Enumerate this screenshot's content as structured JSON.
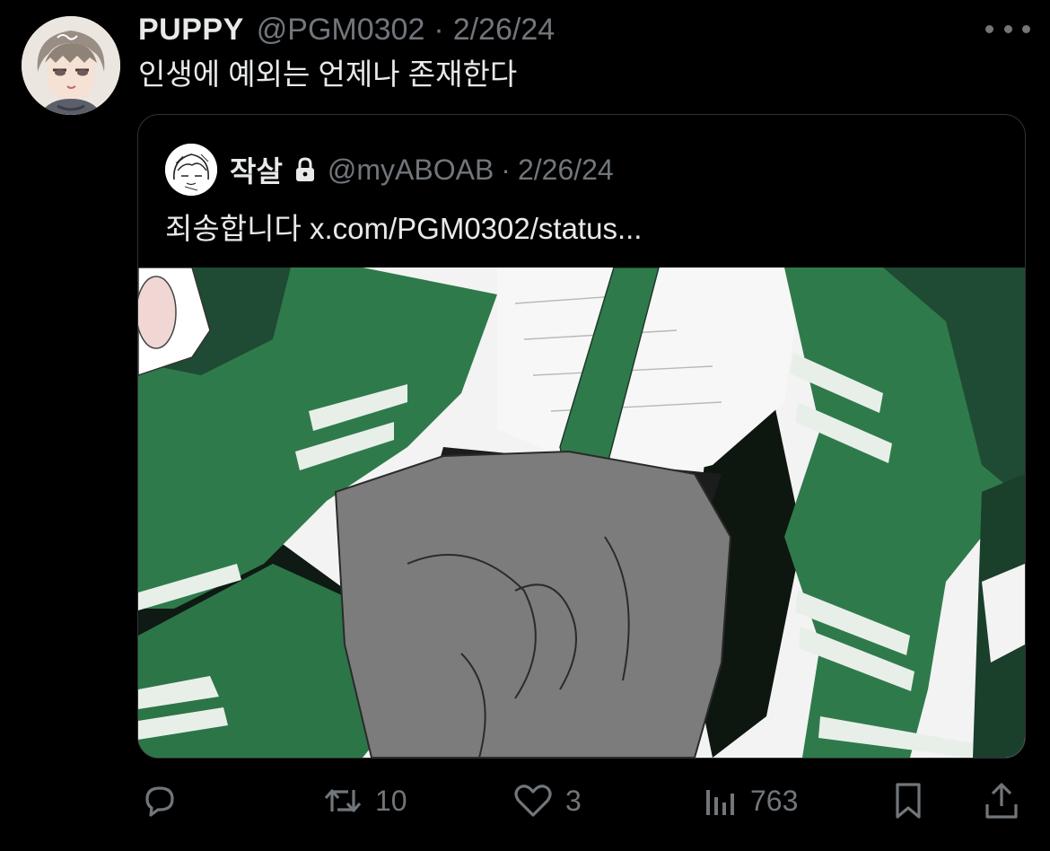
{
  "tweet": {
    "display_name": "PUPPY",
    "handle": "@PGM0302",
    "separator": "·",
    "date": "2/26/24",
    "text": "인생에 예외는 언제나 존재한다",
    "avatar_icon": "profile-avatar",
    "more_icon": "more-horizontal-icon"
  },
  "quote": {
    "display_name": "작살",
    "locked": true,
    "lock_icon": "lock-icon",
    "handle": "@myABOAB",
    "separator": "·",
    "date": "2/26/24",
    "text": "죄송합니다 x.com/PGM0302/status...",
    "image_colors": {
      "green_dark": "#1f4a33",
      "green": "#2f7a4b",
      "stripe": "#e8efe9",
      "gray": "#7c7c7c",
      "white": "#f4f4f4"
    }
  },
  "actions": {
    "reply": {
      "icon": "reply-icon",
      "count": ""
    },
    "retweet": {
      "icon": "retweet-icon",
      "count": "10"
    },
    "like": {
      "icon": "like-icon",
      "count": "3"
    },
    "views": {
      "icon": "views-icon",
      "count": "763"
    },
    "bookmark": {
      "icon": "bookmark-icon",
      "count": ""
    },
    "share": {
      "icon": "share-icon",
      "count": ""
    }
  },
  "colors": {
    "background": "#000000",
    "text_primary": "#e7e9ea",
    "text_secondary": "#71767b",
    "border": "#2f3336"
  }
}
